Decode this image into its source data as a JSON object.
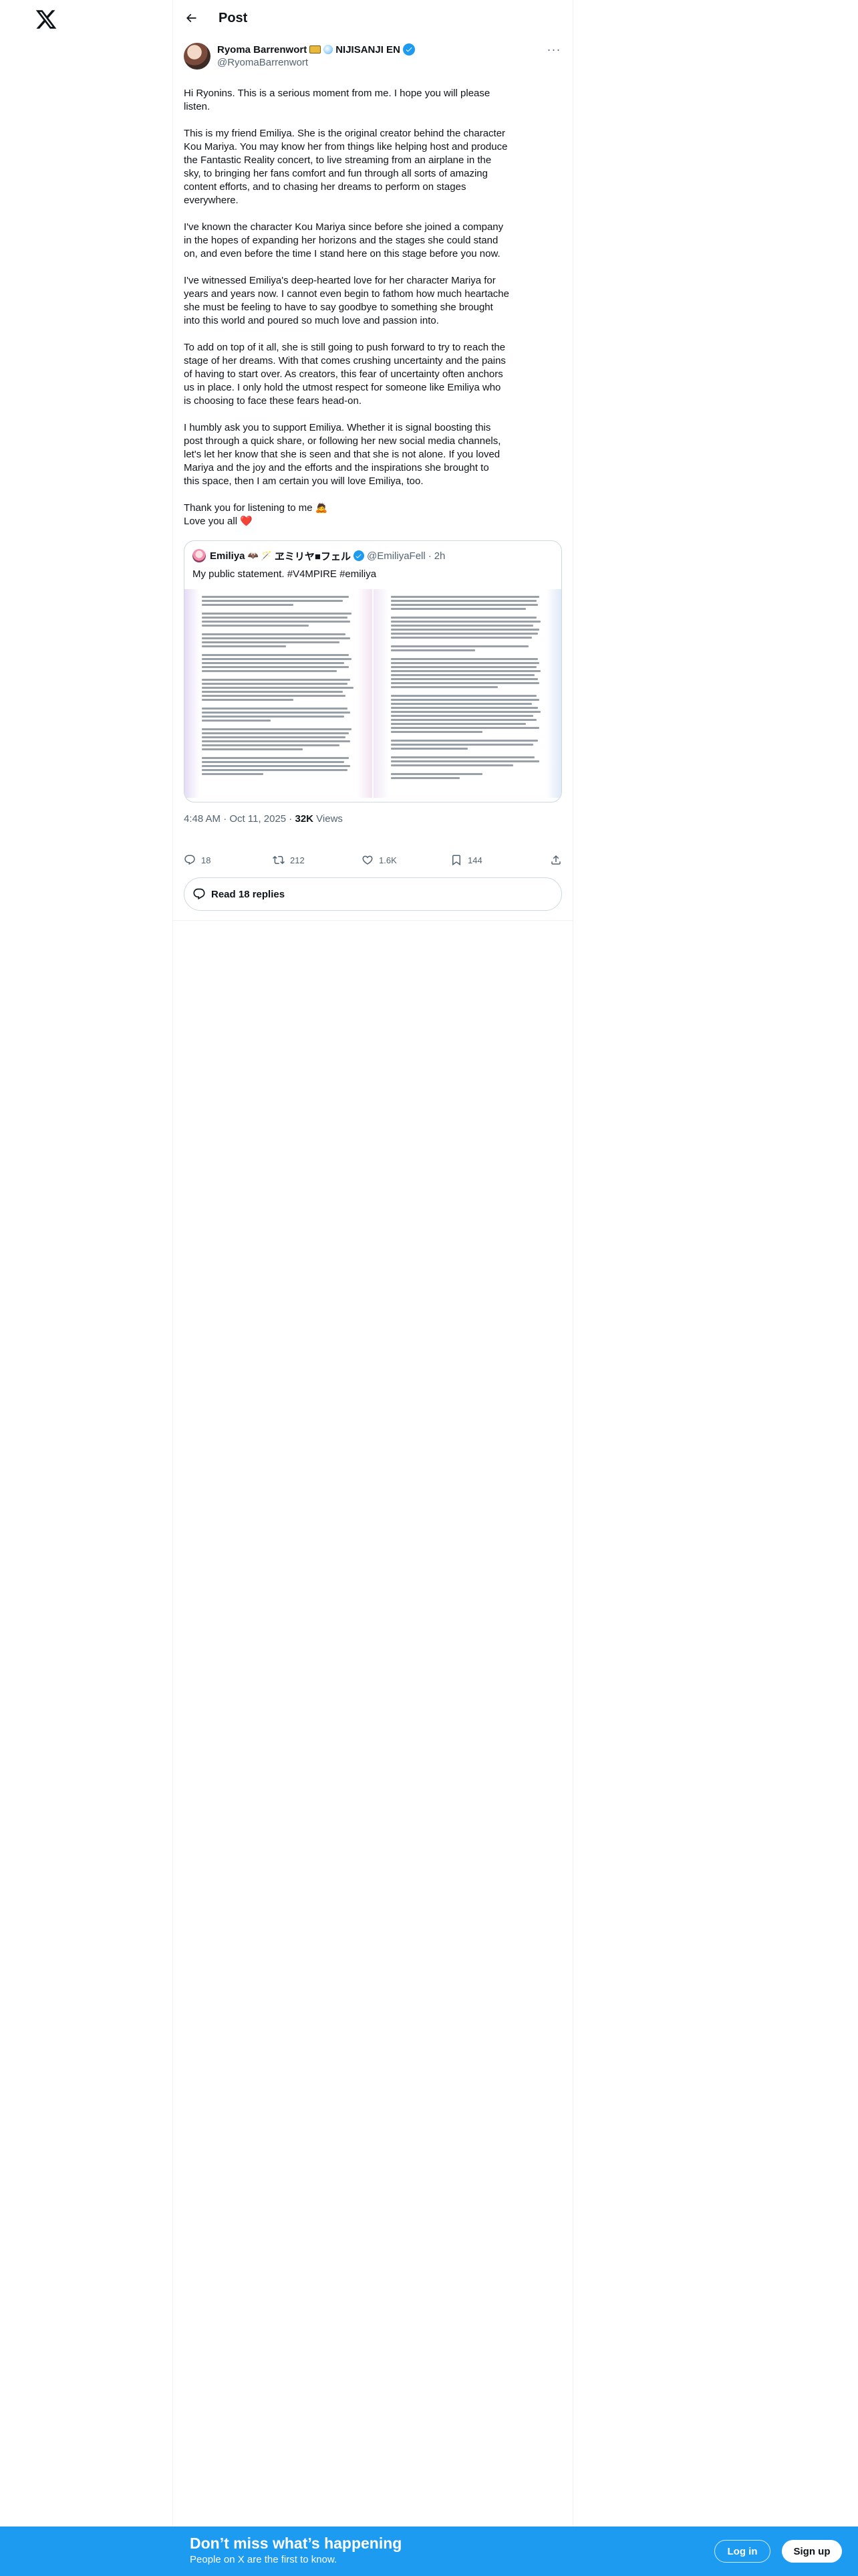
{
  "header": {
    "title": "Post"
  },
  "author": {
    "name": "Ryoma Barrenwort",
    "affiliation": "NIJISANJI EN",
    "handle": "@RyomaBarrenwort"
  },
  "tweet": {
    "paragraphs": [
      [
        "Hi Ryonins. This is a serious moment from me. I hope you will please",
        "listen."
      ],
      [
        "This is my friend Emiliya. She is the original creator behind the character",
        "Kou Mariya. You may know her from things like helping host and produce",
        "the Fantastic Reality concert, to live streaming from an airplane in the",
        "sky, to bringing her fans comfort and fun through all sorts of amazing",
        "content efforts, and to chasing her dreams to perform on stages",
        "everywhere."
      ],
      [
        "I've known the character Kou Mariya since before she joined a company",
        "in the hopes of expanding her horizons and the stages she could stand",
        "on, and even before the time I stand here on this stage before you now."
      ],
      [
        "I've witnessed Emiliya's deep-hearted love for her character Mariya for",
        "years and years now. I cannot even begin to fathom how much heartache",
        "she must be feeling to have to say goodbye to something she brought",
        "into this world and poured so much love and passion into."
      ],
      [
        "To add on top of it all, she is still going to push forward to try to reach the",
        "stage of her dreams. With that comes crushing uncertainty and the pains",
        "of having to start over. As creators, this fear of uncertainty often anchors",
        "us in place. I only hold the utmost respect for someone like Emiliya who",
        "is choosing to face these fears head-on."
      ],
      [
        "I humbly ask you to support Emiliya. Whether it is signal boosting this",
        "post through a quick share, or following her new social media channels,",
        "let's let her know that she is seen and that she is not alone. If you loved",
        "Mariya and the joy and the efforts and the inspirations she brought to",
        "this space, then I am certain you will love Emiliya, too."
      ],
      [
        "Thank you for listening to me 🙇",
        "Love you all ❤️"
      ]
    ]
  },
  "quote": {
    "name": "Emiliya",
    "name_suffix": "ヱミリヤ■フェル",
    "handle": "@EmiliyaFell",
    "time": "2h",
    "text": "My public statement. #V4MPIRE #emiliya"
  },
  "meta": {
    "time": "4:48 AM · Oct 11, 2025 · ",
    "views_count": "32K",
    "views_label": " Views"
  },
  "actions": {
    "replies": "18",
    "reposts": "212",
    "likes": "1.6K",
    "bookmarks": "144"
  },
  "read_replies": "Read 18 replies",
  "banner": {
    "title": "Don’t miss what’s happening",
    "subtitle": "People on X are the first to know.",
    "login": "Log in",
    "signup": "Sign up"
  },
  "colors": {
    "accent": "#1d9bf0",
    "text": "#0f1419",
    "secondary": "#536471",
    "like_heart": "#f91880"
  }
}
